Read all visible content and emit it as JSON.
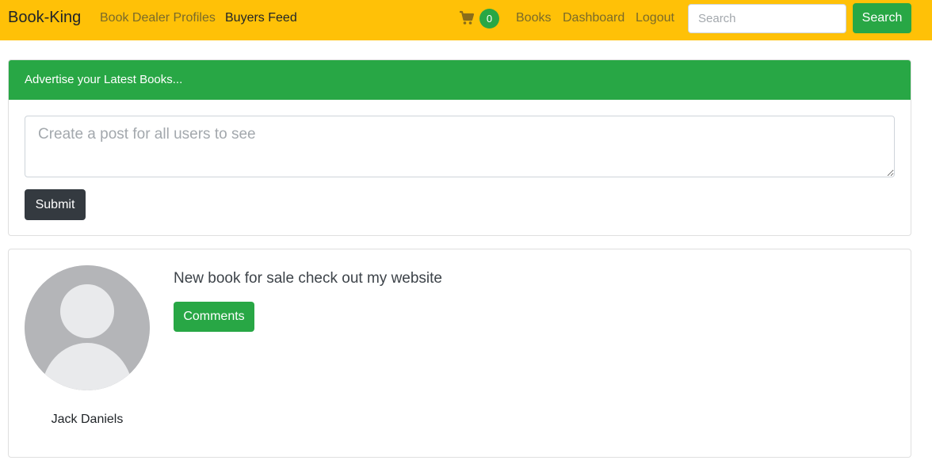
{
  "navbar": {
    "brand": "Book-King",
    "links": [
      "Book Dealer Profiles",
      "Buyers Feed"
    ],
    "cart_count": "0",
    "right_links": [
      "Books",
      "Dashboard",
      "Logout"
    ],
    "search_placeholder": "Search",
    "search_button": "Search",
    "icons": {
      "cart": "shopping-cart-icon"
    }
  },
  "composer": {
    "header": "Advertise your Latest Books...",
    "placeholder": "Create a post for all users to see",
    "submit_label": "Submit"
  },
  "feed": {
    "posts": [
      {
        "author": "Jack Daniels",
        "text": "New book for sale check out my website",
        "comments_label": "Comments",
        "avatar_icon": "default-avatar-icon"
      }
    ]
  },
  "colors": {
    "navbar": "#ffc107",
    "accent_green": "#28a745",
    "dark_button": "#343a40"
  }
}
